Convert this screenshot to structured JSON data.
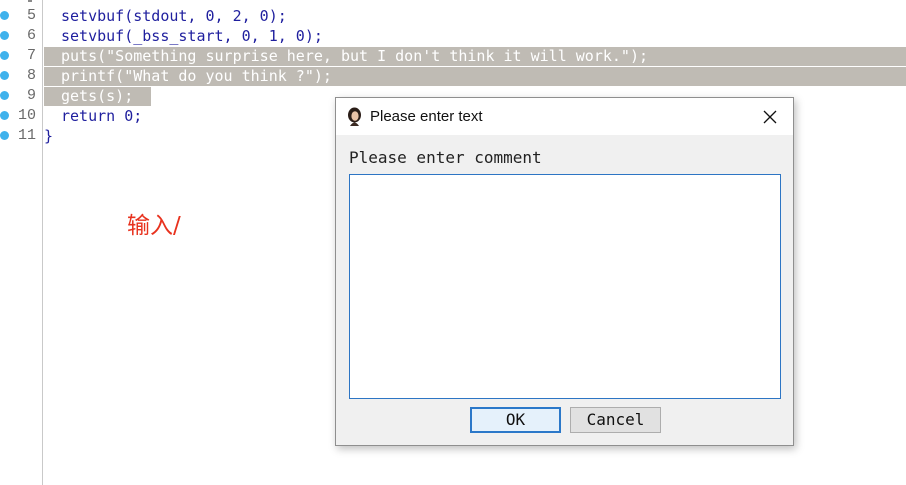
{
  "editor": {
    "lines": [
      {
        "number": "5",
        "code": "setvbuf(stdout, 0, 2, 0);",
        "selected": false
      },
      {
        "number": "6",
        "code": "setvbuf(_bss_start, 0, 1, 0);",
        "selected": false
      },
      {
        "number": "7",
        "code": "puts(\"Something surprise here, but I don't think it will work.\");",
        "selected": true
      },
      {
        "number": "8",
        "code": "printf(\"What do you think ?\");",
        "selected": true
      },
      {
        "number": "9",
        "code": "gets(s);",
        "selected": true
      },
      {
        "number": "10",
        "code": "return 0;",
        "selected": false
      },
      {
        "number": "11",
        "code": "}",
        "selected": false
      }
    ],
    "breakpoint_color": "#3fb2ec",
    "selection_color": "#bfbbb4",
    "code_color": "#1f1f9e"
  },
  "annotation": {
    "text": "输入/",
    "color": "#e8321e"
  },
  "dialog": {
    "title": "Please enter text",
    "icon": "app-avatar-icon",
    "close_icon": "close-icon",
    "prompt": "Please enter comment",
    "comment_value": "",
    "ok_label": "OK",
    "cancel_label": "Cancel"
  }
}
